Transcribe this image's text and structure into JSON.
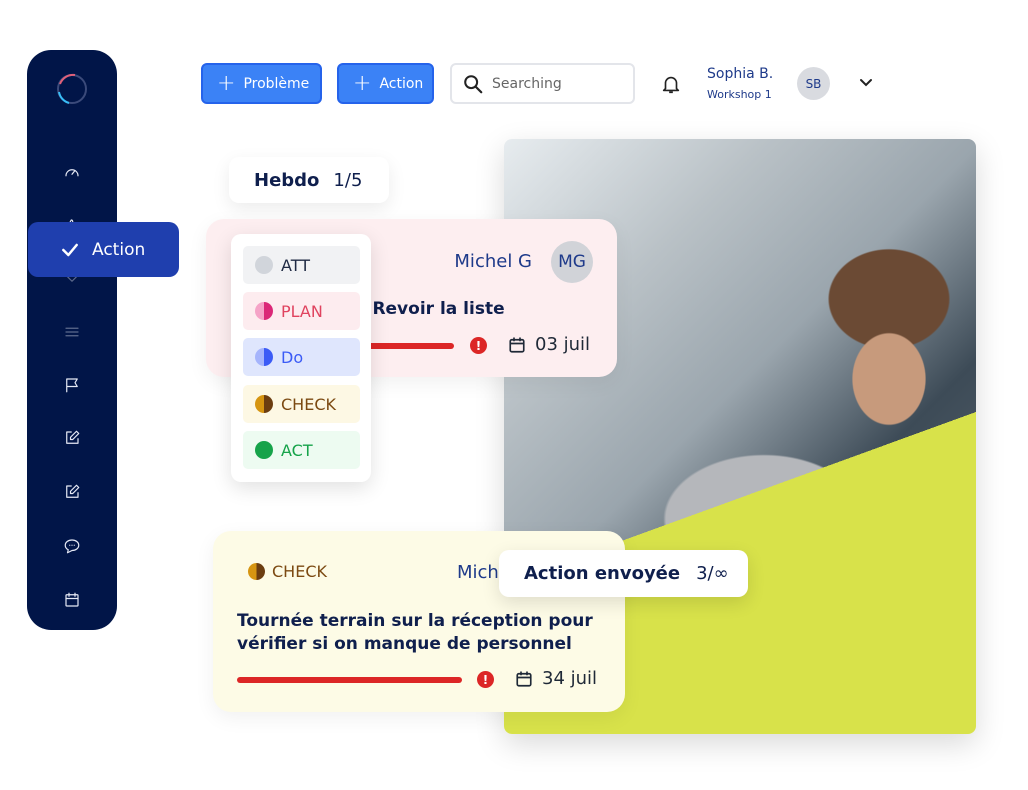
{
  "sidebar": {
    "items": [
      "dashboard-icon",
      "thumbs-up-icon",
      "check-icon",
      "menu-icon",
      "flag-icon",
      "edit-icon",
      "edit-icon",
      "chat-icon",
      "calendar-icon"
    ],
    "tooltip": "Action",
    "colors": {
      "bg": "#011548",
      "tooltip": "#1f3fae"
    }
  },
  "header": {
    "problem_button": "Problème",
    "action_button": "Action",
    "search_placeholder": "Searching",
    "user": {
      "name": "Sophia B.",
      "subtitle": "Workshop 1",
      "initials": "SB"
    }
  },
  "hebdo": {
    "label": "Hebdo",
    "count": "1/5"
  },
  "card_top": {
    "assignee": "Michel G",
    "initials": "MG",
    "title": "ro. Revoir la liste",
    "date": "03 juil",
    "progress_color": "#dc2626"
  },
  "status_menu": [
    {
      "label": "ATT",
      "color": "#d1d5db"
    },
    {
      "label": "PLAN",
      "color": "#db2777"
    },
    {
      "label": "Do",
      "color": "#3b5bf6"
    },
    {
      "label": "CHECK",
      "color": "#b7791f"
    },
    {
      "label": "ACT",
      "color": "#16a34a"
    }
  ],
  "card_bottom": {
    "status": "CHECK",
    "assignee": "Michel G",
    "title_line1": "Tournée terrain sur la réception pour",
    "title_line2": "vérifier si on manque de personnel",
    "date": "34 juil"
  },
  "sent_pill": {
    "label": "Action envoyée",
    "count": "3/∞"
  }
}
